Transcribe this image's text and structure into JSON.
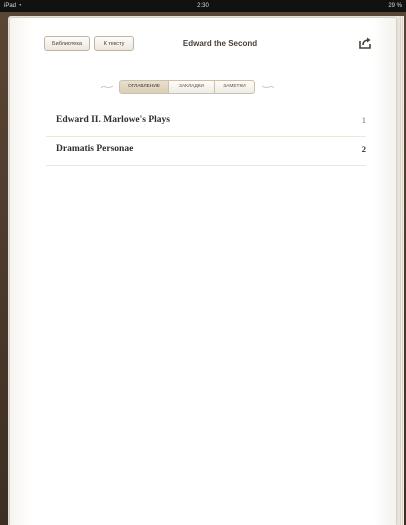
{
  "status_bar": {
    "device": "iPad",
    "time": "2:30",
    "battery": "29 %"
  },
  "toolbar": {
    "library_label": "Библиотека",
    "back_label": "К тексту",
    "book_title": "Edward the Second"
  },
  "tabs": [
    {
      "label": "ОГЛАВЛЕНИЕ",
      "active": true
    },
    {
      "label": "ЗАКЛАДКИ",
      "active": false
    },
    {
      "label": "ЗАМЕТКИ",
      "active": false
    }
  ],
  "toc": [
    {
      "title": "Edward II. Marlowe's Plays",
      "page": "1"
    },
    {
      "title": "Dramatis Personae",
      "page": "2"
    }
  ],
  "icons": {
    "share": "share-icon",
    "wifi": "wifi-icon"
  },
  "colors": {
    "leather": "#3d2f24",
    "page": "#ffffff",
    "active_tab": "#d9ceb7"
  }
}
